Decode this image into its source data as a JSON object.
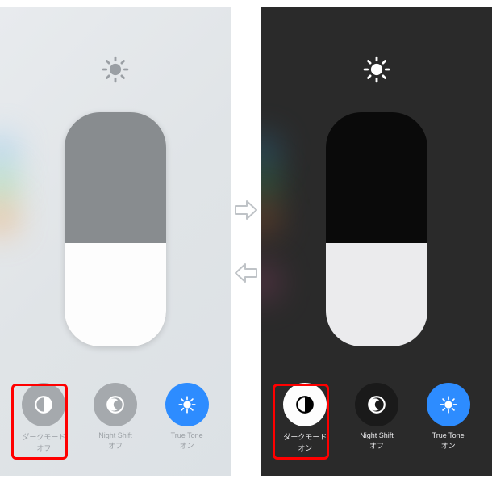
{
  "left_panel": {
    "mode": "light",
    "brightness_fill_percent": 44,
    "toggles": {
      "dark_mode": {
        "label": "ダークモード",
        "status": "オフ"
      },
      "night_shift": {
        "label": "Night Shift",
        "status": "オフ"
      },
      "true_tone": {
        "label": "True Tone",
        "status": "オン"
      }
    }
  },
  "right_panel": {
    "mode": "dark",
    "brightness_fill_percent": 44,
    "toggles": {
      "dark_mode": {
        "label": "ダークモード",
        "status": "オン"
      },
      "night_shift": {
        "label": "Night Shift",
        "status": "オフ"
      },
      "true_tone": {
        "label": "True Tone",
        "status": "オン"
      }
    }
  },
  "colors": {
    "highlight": "#ff0000",
    "blue": "#2d8cff"
  }
}
